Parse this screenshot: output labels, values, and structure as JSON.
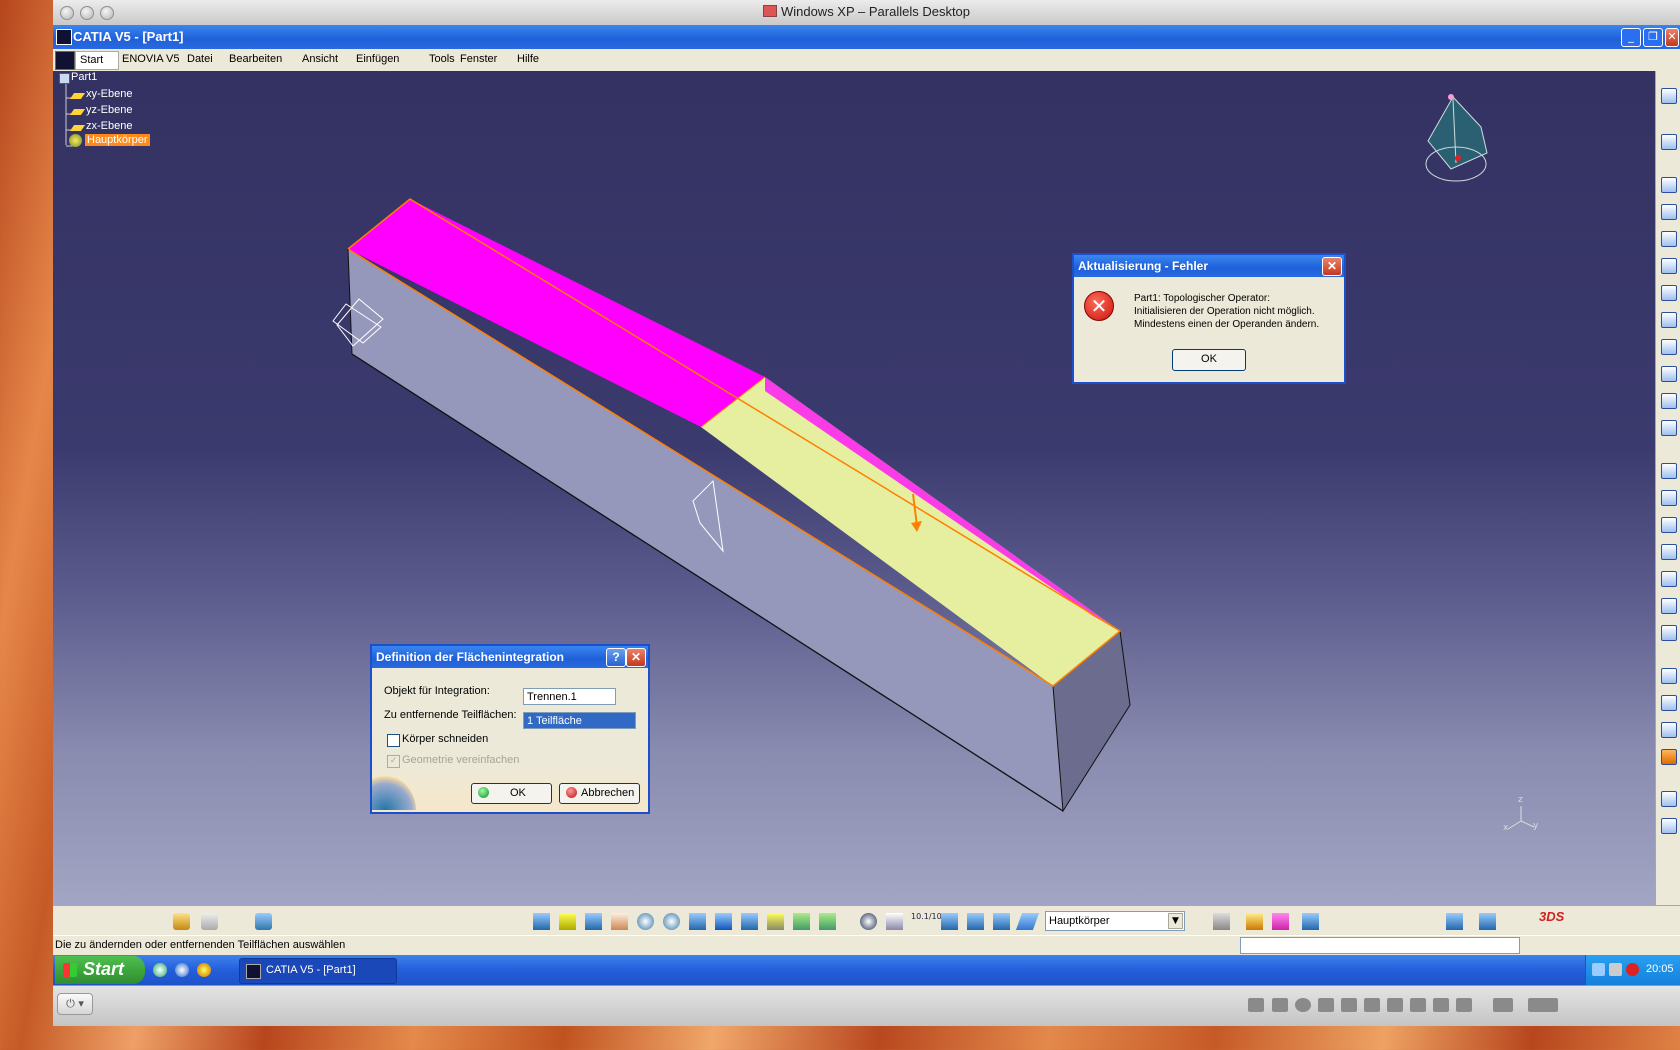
{
  "mac": {
    "title": "Windows XP – Parallels Desktop"
  },
  "xp": {
    "title": "CATIA V5 - [Part1]"
  },
  "menu": {
    "start": "Start",
    "enovia": "ENOVIA V5",
    "datei": "Datei",
    "bearbeiten": "Bearbeiten",
    "ansicht": "Ansicht",
    "einfuegen": "Einfügen",
    "tools": "Tools",
    "fenster": "Fenster",
    "hilfe": "Hilfe"
  },
  "tree": {
    "root": "Part1",
    "items": [
      "xy-Ebene",
      "yz-Ebene",
      "zx-Ebene"
    ],
    "selected": "Hauptkörper"
  },
  "error_dialog": {
    "title": "Aktualisierung - Fehler",
    "line1": "Part1: Topologischer Operator:",
    "line2": "Initialisieren der Operation nicht möglich.",
    "line3": "Mindestens einen der Operanden ändern.",
    "ok": "OK"
  },
  "surface_dialog": {
    "title": "Definition der Flächenintegration",
    "help": "?",
    "object_label": "Objekt für Integration:",
    "object_value": "Trennen.1",
    "faces_label": "Zu entfernende Teilflächen:",
    "faces_value": "1 Teilfläche",
    "cut_body": "Körper schneiden",
    "simplify": "Geometrie vereinfachen",
    "ok": "OK",
    "cancel": "Abbrechen"
  },
  "toolbar": {
    "body_select": "Hauptkörper",
    "scale_label": "10.1/10.0"
  },
  "status": {
    "text": "Die zu ändernden oder entfernenden Teilflächen auswählen"
  },
  "taskbar": {
    "start": "Start",
    "task": "CATIA V5 - [Part1]",
    "clock": "20:05"
  },
  "compass": {
    "x": "x",
    "y": "y",
    "z": "z"
  },
  "colors": {
    "face_selected": "#ff00ff",
    "face_highlight": "#e6eea0",
    "edge_highlight": "#ff7f00",
    "xp_blue": "#245edc"
  }
}
